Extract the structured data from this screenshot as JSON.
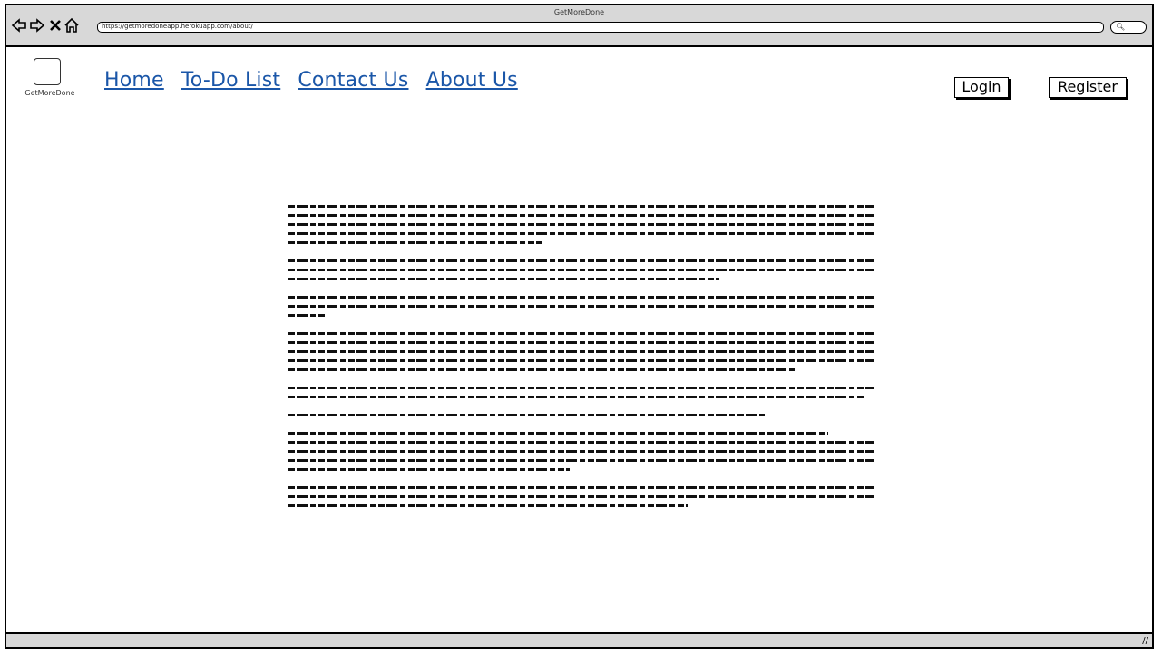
{
  "window": {
    "title": "GetMoreDone"
  },
  "browser": {
    "url": "https://getmoredoneapp.herokuapp.com/about/",
    "back_icon": "back-arrow-icon",
    "forward_icon": "forward-arrow-icon",
    "stop_icon": "close-icon",
    "home_icon": "home-icon",
    "search_icon": "search-icon"
  },
  "header": {
    "logo_text": "GetMoreDone",
    "nav": [
      "Home",
      "To-Do List",
      "Contact Us",
      "About Us"
    ],
    "login_label": "Login",
    "register_label": "Register"
  },
  "main": {
    "paragraphs": [
      [
        "—",
        "—",
        "—",
        "—",
        "—"
      ],
      [
        "—",
        "—",
        "—"
      ],
      [
        "—",
        "—",
        "—"
      ],
      [
        "—",
        "—",
        "—",
        "—",
        "—"
      ],
      [
        "—",
        "—"
      ],
      [
        "—"
      ],
      [
        "—",
        "—",
        "—",
        "—",
        "—"
      ],
      [
        "—",
        "—",
        "—"
      ]
    ]
  }
}
